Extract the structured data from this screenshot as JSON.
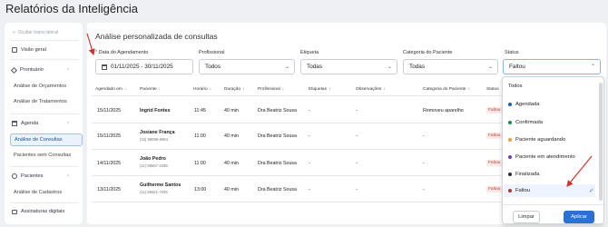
{
  "page_title": "Relatórios da Inteligência",
  "sidebar": {
    "collapse_label": "Ocultar barra lateral",
    "items": [
      {
        "label": "Visão geral",
        "icon": "grid-icon"
      },
      {
        "label": "Prontuário",
        "icon": "diamond-icon"
      },
      {
        "label": "Análise de Orçamentos"
      },
      {
        "label": "Análise de Tratamentos"
      },
      {
        "label": "Agenda",
        "icon": "calendar-icon"
      },
      {
        "label": "Análise de Consultas"
      },
      {
        "label": "Pacientes sem Consultas"
      },
      {
        "label": "Pacientes",
        "icon": "user-icon"
      },
      {
        "label": "Análise de Cadastros"
      },
      {
        "label": "Assinaturas digitais",
        "icon": "card-icon"
      }
    ]
  },
  "main": {
    "title": "Análise personalizada de consultas",
    "filters": {
      "date_label": "Data do Agendamento",
      "date_required": "*",
      "date_value": "01/11/2025 - 30/11/2025",
      "professional_label": "Profissional",
      "professional_value": "Todos",
      "tag_label": "Etiqueta",
      "tag_value": "Todas",
      "category_label": "Categoria do Paciente",
      "category_value": "Todas",
      "status_label": "Status",
      "status_value": "Faltou"
    },
    "columns": [
      "Agendado em",
      "Paciente",
      "Horário",
      "Duração",
      "Profissional",
      "Etiquetas",
      "Observações",
      "Categoria do Paciente",
      "Status"
    ],
    "rows": [
      {
        "date": "15/11/2025",
        "patient": "Ingrid Fontes",
        "phone": "",
        "time": "11:45",
        "duration": "40 min",
        "professional": "Dra Beatriz Sousa",
        "tags": "-",
        "notes": "-",
        "category": "Removeu aparelho",
        "status": "Faltou"
      },
      {
        "date": "15/11/2025",
        "patient": "Josiane França",
        "phone": "(32) 98696-5984",
        "time": "11:00",
        "duration": "40 min",
        "professional": "Dra Beatriz Sousa",
        "tags": "-",
        "notes": "-",
        "category": "-",
        "status": "Faltou"
      },
      {
        "date": "14/11/2025",
        "patient": "João Pedro",
        "phone": "(11) 98567-2288",
        "time": "11:00",
        "duration": "40 min",
        "professional": "Dra Beatriz Sousa",
        "tags": "-",
        "notes": "-",
        "category": "-",
        "status": "Faltou"
      },
      {
        "date": "13/11/2025",
        "patient": "Guilherme Santos",
        "phone": "(11) 96621-7206",
        "time": "13:00",
        "duration": "40 min",
        "professional": "Dra Beatriz Sousa",
        "tags": "-",
        "notes": "-",
        "category": "-",
        "status": "Faltou"
      }
    ]
  },
  "status_dropdown": {
    "options": [
      {
        "label": "Todos",
        "color": ""
      },
      {
        "label": "Agendada",
        "color": "#1f5fae"
      },
      {
        "label": "Confirmada",
        "color": "#1e8a4c"
      },
      {
        "label": "Paciente aguardando",
        "color": "#e9a13b"
      },
      {
        "label": "Paciente em atendimento",
        "color": "#6d3fb0"
      },
      {
        "label": "Finalizada",
        "color": "#2b2f36"
      },
      {
        "label": "Faltou",
        "color": "#b03a2e",
        "selected": true
      }
    ],
    "check_icon": "check-icon",
    "clear_label": "Limpar",
    "apply_label": "Aplicar"
  },
  "colors": {
    "accent": "#2d6fd8",
    "annotation_arrow": "#d6302c"
  }
}
